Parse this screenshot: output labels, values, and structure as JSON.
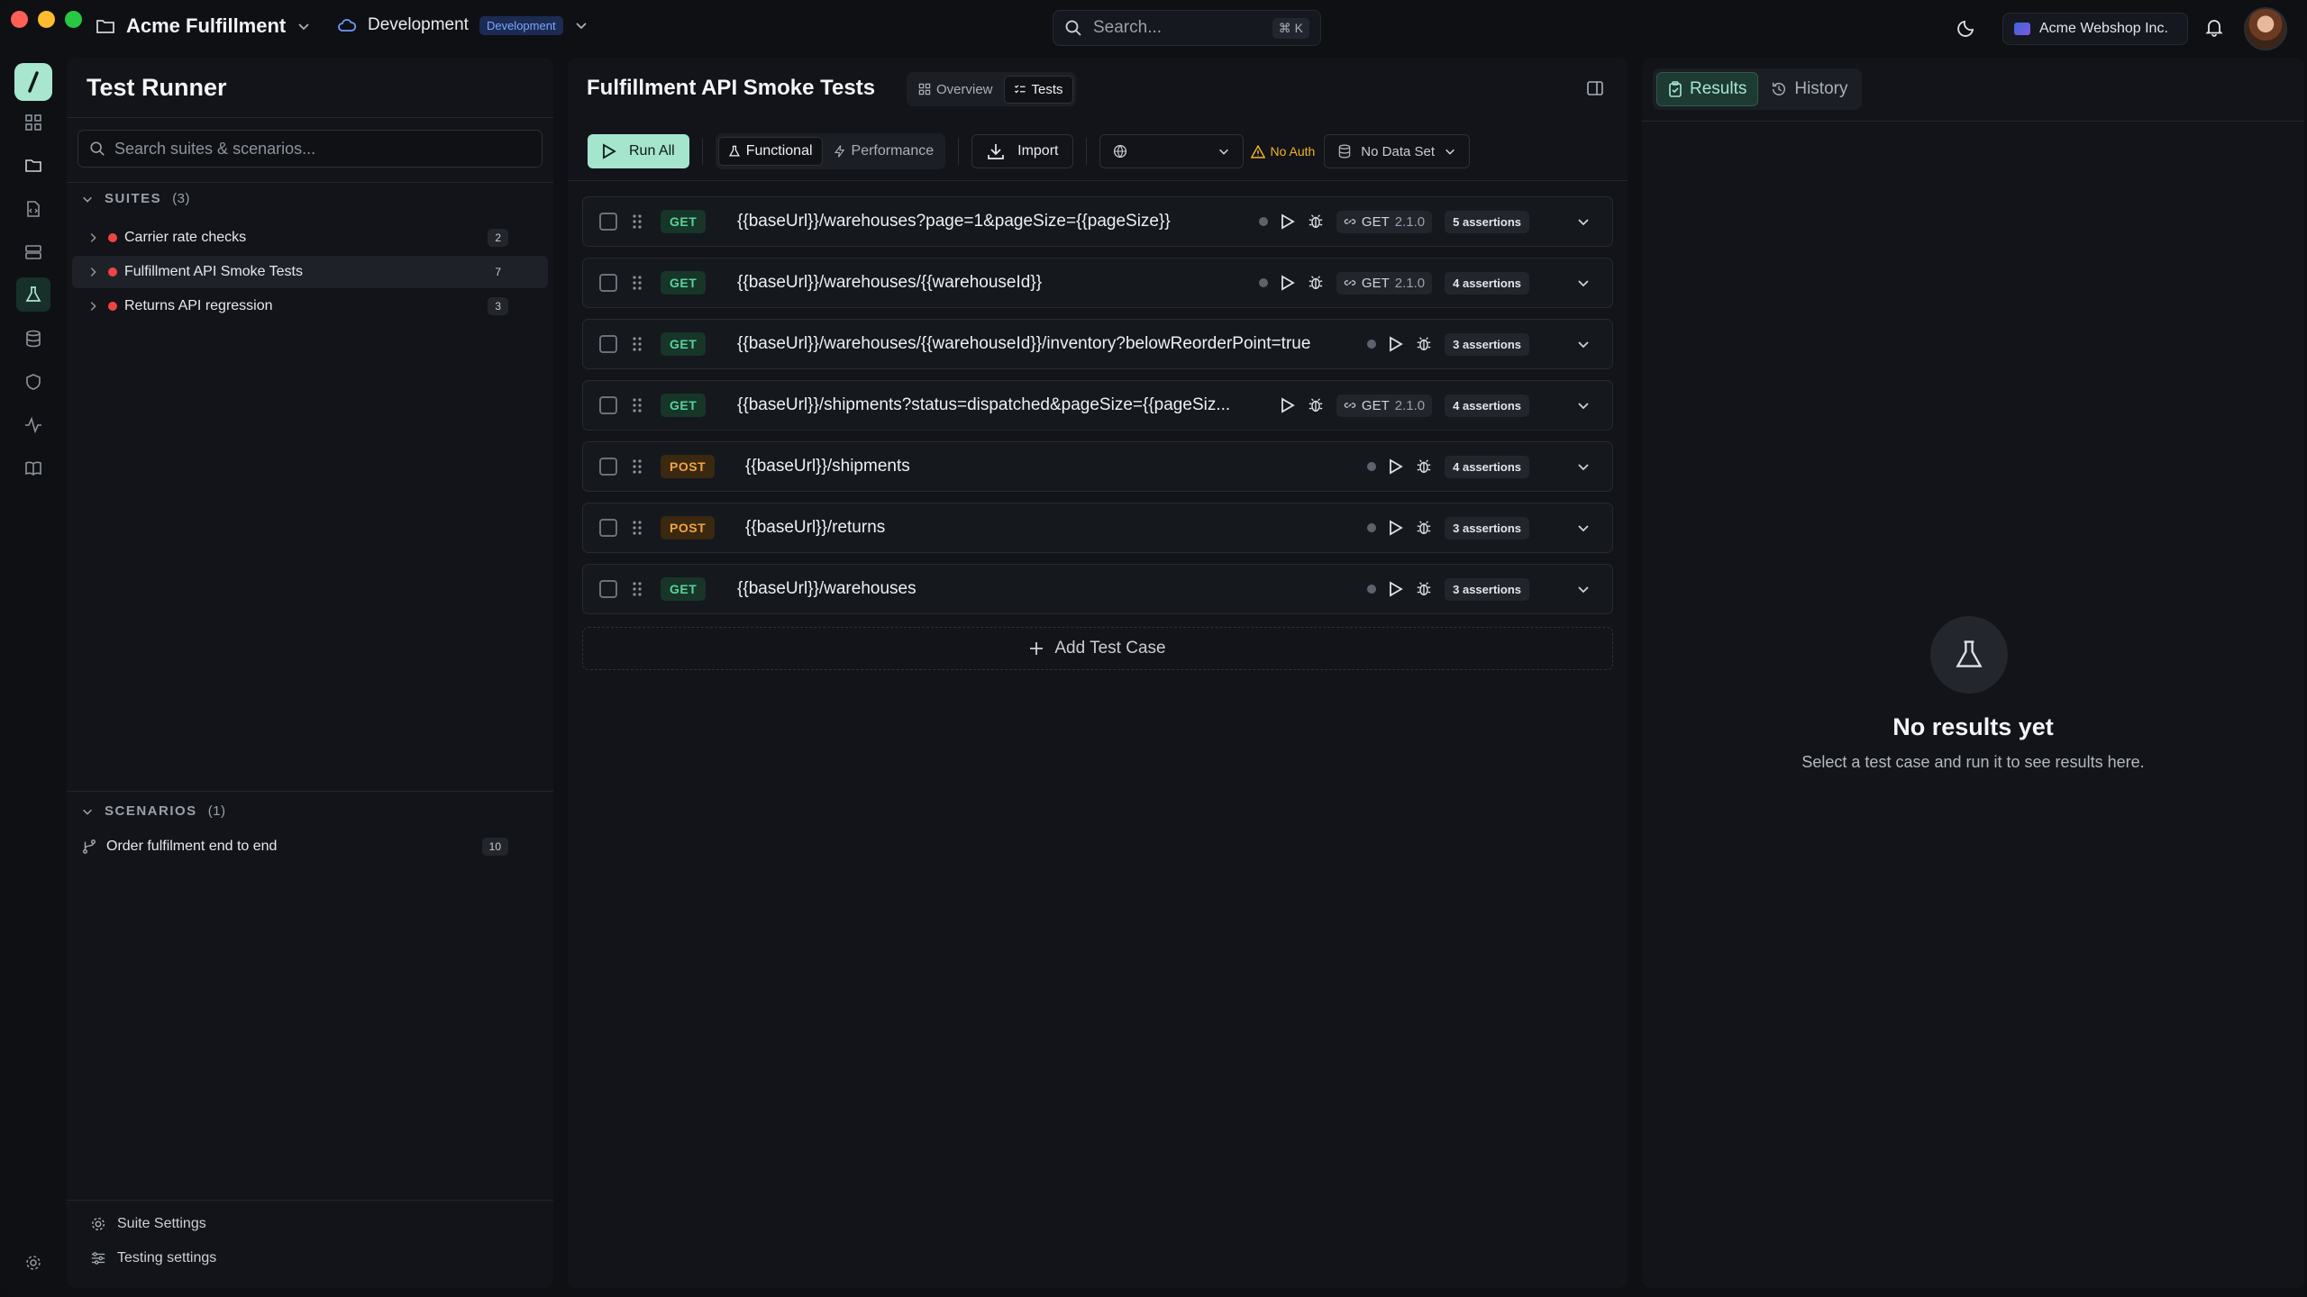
{
  "topbar": {
    "project": "Acme Fulfillment",
    "environment": "Development",
    "environment_badge": "Development",
    "search_placeholder": "Search...",
    "search_shortcut": "⌘ K",
    "org": "Acme Webshop Inc."
  },
  "left": {
    "title": "Test Runner",
    "search_placeholder": "Search suites & scenarios...",
    "suites_heading": "SUITES",
    "suites_count": "(3)",
    "suites": [
      {
        "name": "Carrier rate checks",
        "count": "2"
      },
      {
        "name": "Fulfillment API Smoke Tests",
        "count": "7"
      },
      {
        "name": "Returns API regression",
        "count": "3"
      }
    ],
    "scenarios_heading": "SCENARIOS",
    "scenarios_count": "(1)",
    "scenarios": [
      {
        "name": "Order fulfilment end to end",
        "count": "10"
      }
    ],
    "footer": {
      "suite_settings": "Suite Settings",
      "testing_settings": "Testing settings"
    }
  },
  "main": {
    "title": "Fulfillment API Smoke Tests",
    "tabs": {
      "overview": "Overview",
      "tests": "Tests"
    },
    "toolbar": {
      "run_all": "Run All",
      "functional": "Functional",
      "performance": "Performance",
      "import": "Import",
      "no_auth": "No Auth",
      "dataset": "No Data Set"
    },
    "tests": [
      {
        "method": "GET",
        "url": "{{baseUrl}}/warehouses?page=1&pageSize={{pageSize}}",
        "version": "GET",
        "version_num": "2.1.0",
        "assertions": "5 assertions"
      },
      {
        "method": "GET",
        "url": "{{baseUrl}}/warehouses/{{warehouseId}}",
        "version": "GET",
        "version_num": "2.1.0",
        "assertions": "4 assertions"
      },
      {
        "method": "GET",
        "url": "{{baseUrl}}/warehouses/{{warehouseId}}/inventory?belowReorderPoint=true",
        "assertions": "3 assertions"
      },
      {
        "method": "GET",
        "url": "{{baseUrl}}/shipments?status=dispatched&pageSize={{pageSiz...",
        "version": "GET",
        "version_num": "2.1.0",
        "assertions": "4 assertions"
      },
      {
        "method": "POST",
        "url": "{{baseUrl}}/shipments",
        "assertions": "4 assertions"
      },
      {
        "method": "POST",
        "url": "{{baseUrl}}/returns",
        "assertions": "3 assertions"
      },
      {
        "method": "GET",
        "url": "{{baseUrl}}/warehouses",
        "assertions": "3 assertions"
      }
    ],
    "add_test_case": "Add Test Case"
  },
  "right": {
    "tabs": {
      "results": "Results",
      "history": "History"
    },
    "empty_title": "No results yet",
    "empty_sub": "Select a test case and run it to see results here."
  },
  "colors": {
    "accent": "#a8e6cf",
    "get": "#57d39b",
    "post": "#f3a43c",
    "warning": "#f0b429",
    "error": "#ef4444"
  }
}
